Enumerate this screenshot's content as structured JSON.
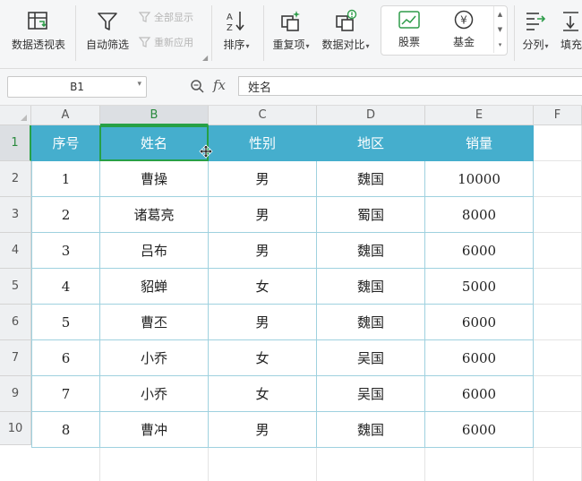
{
  "ribbon": {
    "pivot_label": "数据透视表",
    "autofilter_label": "自动筛选",
    "show_all_label": "全部显示",
    "reapply_label": "重新应用",
    "sort_label": "排序",
    "duplicates_label": "重复项",
    "compare_label": "数据对比",
    "stock_label": "股票",
    "fund_label": "基金",
    "fund_icon_glyph": "¥",
    "split_label": "分列",
    "fill_label": "填充",
    "caret": "▾"
  },
  "formula_bar": {
    "name_box": "B1",
    "fx": "fx",
    "content": "姓名"
  },
  "columns": [
    "A",
    "B",
    "C",
    "D",
    "E",
    "F"
  ],
  "rows": [
    "1",
    "2",
    "3",
    "4",
    "5",
    "6",
    "7",
    "9",
    "10"
  ],
  "table": {
    "headers": [
      "序号",
      "姓名",
      "性别",
      "地区",
      "销量"
    ],
    "rows": [
      [
        "1",
        "曹操",
        "男",
        "魏国",
        "10000"
      ],
      [
        "2",
        "诸葛亮",
        "男",
        "蜀国",
        "8000"
      ],
      [
        "3",
        "吕布",
        "男",
        "魏国",
        "6000"
      ],
      [
        "4",
        "貂蝉",
        "女",
        "魏国",
        "5000"
      ],
      [
        "5",
        "曹丕",
        "男",
        "魏国",
        "6000"
      ],
      [
        "6",
        "小乔",
        "女",
        "吴国",
        "6000"
      ],
      [
        "7",
        "小乔",
        "女",
        "吴国",
        "6000"
      ],
      [
        "8",
        "曹冲",
        "男",
        "魏国",
        "6000"
      ]
    ]
  },
  "colors": {
    "header_fill": "#45aecd",
    "table_border": "#9fd1df",
    "selection": "#27a045"
  },
  "icons": [
    "pivot-table-icon",
    "filter-icon",
    "show-all-icon",
    "reapply-icon",
    "sort-icon",
    "duplicates-icon",
    "compare-icon",
    "stock-icon",
    "fund-icon",
    "split-icon",
    "fill-icon",
    "zoom-icon",
    "move-cursor-icon"
  ]
}
